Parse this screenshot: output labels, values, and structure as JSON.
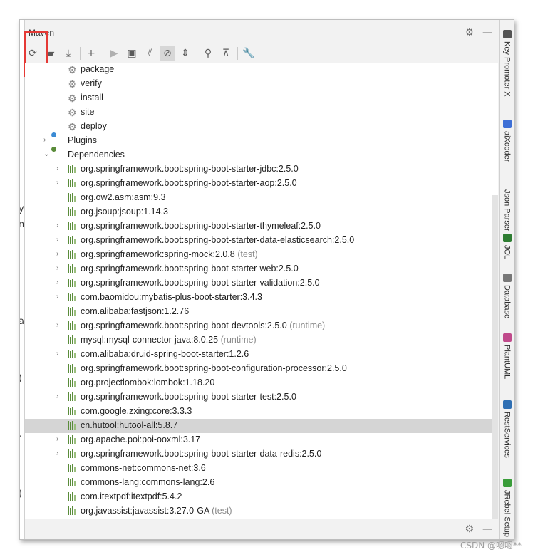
{
  "window": {
    "title": "Maven"
  },
  "toolbar": {
    "buttons": [
      {
        "name": "reload-all-projects",
        "icon": "refresh-icon"
      },
      {
        "name": "reimport-folder",
        "icon": "folder-refresh-icon"
      },
      {
        "name": "download-sources",
        "icon": "download-icon"
      },
      {
        "name": "add-project",
        "icon": "plus-icon"
      },
      {
        "name": "run",
        "icon": "play-icon"
      },
      {
        "name": "execute-goal",
        "icon": "terminal-icon"
      },
      {
        "name": "toggle-offline",
        "icon": "offline-icon"
      },
      {
        "name": "skip-tests",
        "icon": "skip-tests-icon"
      },
      {
        "name": "collapse",
        "icon": "collapse-icon"
      },
      {
        "name": "show-dependencies",
        "icon": "dependencies-icon"
      },
      {
        "name": "collapse-all",
        "icon": "collapse-all-icon"
      },
      {
        "name": "settings",
        "icon": "wrench-icon"
      }
    ]
  },
  "tree": {
    "lifecycle": [
      "package",
      "verify",
      "install",
      "site",
      "deploy"
    ],
    "plugins_label": "Plugins",
    "dependencies_label": "Dependencies",
    "dependencies": [
      {
        "name": "org.springframework.boot:spring-boot-starter-jdbc:2.5.0",
        "scope": "",
        "expandable": true
      },
      {
        "name": "org.springframework.boot:spring-boot-starter-aop:2.5.0",
        "scope": "",
        "expandable": true
      },
      {
        "name": "org.ow2.asm:asm:9.3",
        "scope": "",
        "expandable": false
      },
      {
        "name": "org.jsoup:jsoup:1.14.3",
        "scope": "",
        "expandable": false
      },
      {
        "name": "org.springframework.boot:spring-boot-starter-thymeleaf:2.5.0",
        "scope": "",
        "expandable": true
      },
      {
        "name": "org.springframework.boot:spring-boot-starter-data-elasticsearch:2.5.0",
        "scope": "",
        "expandable": true
      },
      {
        "name": "org.springframework:spring-mock:2.0.8",
        "scope": "(test)",
        "expandable": true
      },
      {
        "name": "org.springframework.boot:spring-boot-starter-web:2.5.0",
        "scope": "",
        "expandable": true
      },
      {
        "name": "org.springframework.boot:spring-boot-starter-validation:2.5.0",
        "scope": "",
        "expandable": true
      },
      {
        "name": "com.baomidou:mybatis-plus-boot-starter:3.4.3",
        "scope": "",
        "expandable": true
      },
      {
        "name": "com.alibaba:fastjson:1.2.76",
        "scope": "",
        "expandable": false
      },
      {
        "name": "org.springframework.boot:spring-boot-devtools:2.5.0",
        "scope": "(runtime)",
        "expandable": true
      },
      {
        "name": "mysql:mysql-connector-java:8.0.25",
        "scope": "(runtime)",
        "expandable": false
      },
      {
        "name": "com.alibaba:druid-spring-boot-starter:1.2.6",
        "scope": "",
        "expandable": true
      },
      {
        "name": "org.springframework.boot:spring-boot-configuration-processor:2.5.0",
        "scope": "",
        "expandable": false
      },
      {
        "name": "org.projectlombok:lombok:1.18.20",
        "scope": "",
        "expandable": false
      },
      {
        "name": "org.springframework.boot:spring-boot-starter-test:2.5.0",
        "scope": "",
        "expandable": true
      },
      {
        "name": "com.google.zxing:core:3.3.3",
        "scope": "",
        "expandable": false
      },
      {
        "name": "cn.hutool:hutool-all:5.8.7",
        "scope": "",
        "expandable": false,
        "selected": true
      },
      {
        "name": "org.apache.poi:poi-ooxml:3.17",
        "scope": "",
        "expandable": true
      },
      {
        "name": "org.springframework.boot:spring-boot-starter-data-redis:2.5.0",
        "scope": "",
        "expandable": true
      },
      {
        "name": "commons-net:commons-net:3.6",
        "scope": "",
        "expandable": false
      },
      {
        "name": "commons-lang:commons-lang:2.6",
        "scope": "",
        "expandable": false
      },
      {
        "name": "com.itextpdf:itextpdf:5.4.2",
        "scope": "",
        "expandable": false
      },
      {
        "name": "org.javassist:javassist:3.27.0-GA",
        "scope": "(test)",
        "expandable": false
      }
    ]
  },
  "right_tabs": [
    {
      "label": "Key Promoter X",
      "icon_color": "#555555"
    },
    {
      "label": "aiXcoder",
      "icon_color": "#3d6fd6"
    },
    {
      "label": "Json Parser",
      "icon_color": "#f2f2f2"
    },
    {
      "label": "JOL",
      "icon_color": "#2e7d32"
    },
    {
      "label": "Database",
      "icon_color": "#777777"
    },
    {
      "label": "PlantUML",
      "icon_color": "#c04a8b"
    },
    {
      "label": "RestServices",
      "icon_color": "#2f6fb3"
    },
    {
      "label": "JRebel Setup",
      "icon_color": "#3a9d3a"
    }
  ],
  "left_fragments": [
    "y",
    "n",
    "a",
    "(",
    "·",
    "("
  ],
  "watermark": "CSDN @嗯嗯**",
  "colors": {
    "accent_red": "#e53935",
    "selection": "#d5d5d5",
    "dependency_icon": "#5a8c3a"
  }
}
